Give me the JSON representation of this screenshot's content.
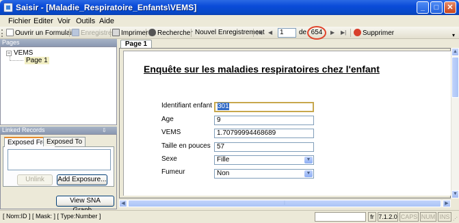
{
  "window": {
    "title": "Saisir - [Maladie_Respiratoire_Enfants\\VEMS]",
    "min": "_",
    "max": "□",
    "close": "✕"
  },
  "menu": [
    "Fichier",
    "Editer",
    "Voir",
    "Outils",
    "Aide"
  ],
  "toolbar": {
    "open_form": "Ouvrir un Formulaire",
    "save": "Enregistrer",
    "print": "Imprimer",
    "search": "Rechercher",
    "new_record": "Nouvel Enregistrement",
    "first": "|◀",
    "prev": "◀",
    "current_record": "1",
    "of": "de",
    "total_records": "654",
    "next": "▶",
    "last": "▶|",
    "delete": "Supprimer"
  },
  "pages_pane": {
    "header": "Pages",
    "root": "VEMS",
    "root_toggle": "−",
    "child": "Page 1"
  },
  "linked_pane": {
    "header": "Linked Records",
    "tabs": [
      "Exposed From",
      "Exposed To"
    ],
    "unlink": "Unlink",
    "add_exposure": "Add Exposure...",
    "view_sna": "View SNA Graph..."
  },
  "form": {
    "tab": "Page 1",
    "heading": "Enquête sur les maladies respiratoires chez l'enfant",
    "fields": [
      {
        "label": "Identifiant enfant",
        "value": "301"
      },
      {
        "label": "Age",
        "value": "9"
      },
      {
        "label": "VEMS",
        "value": "1.70799994468689"
      },
      {
        "label": "Taille en pouces",
        "value": "57"
      },
      {
        "label": "Sexe",
        "value": "Fille"
      },
      {
        "label": "Fumeur",
        "value": "Non"
      }
    ]
  },
  "status": {
    "info": "[ Nom:ID ] [ Mask: ] [ Type:Number ]",
    "lang": "fr",
    "version": "7.1.2.0",
    "caps": "CAPS",
    "num": "NUM",
    "ins": "INS"
  },
  "colors": {
    "titlebar": "#0a4bd9",
    "highlight": "#e0442b",
    "selection": "#316ac5"
  }
}
